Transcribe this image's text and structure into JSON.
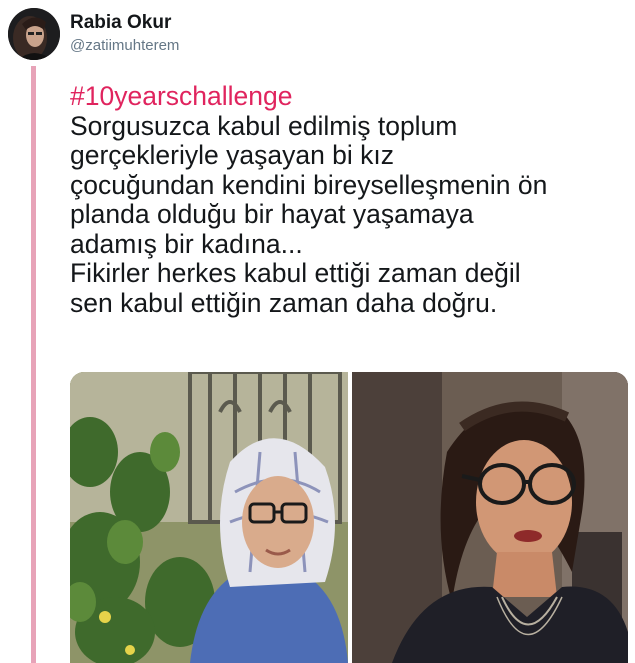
{
  "user": {
    "name": "Rabia Okur",
    "handle": "@zatiimuhterem"
  },
  "tweet": {
    "hashtag": "#10yearschallenge",
    "lines": [
      "Sorgusuzca kabul edilmiş toplum",
      "gerçekleriyle  yaşayan bi kız",
      "çocuğundan kendini bireyselleşmenin ön",
      "planda olduğu bir hayat yaşamaya",
      "adamış bir kadına...",
      "Fikirler herkes kabul ettiği zaman değil",
      "sen kabul ettiğin zaman daha doğru."
    ]
  },
  "colors": {
    "hashtag": "#e0245e",
    "thread_line": "#e7a3b8",
    "handle": "#657786"
  },
  "icons": {
    "avatar": "profile-photo"
  }
}
